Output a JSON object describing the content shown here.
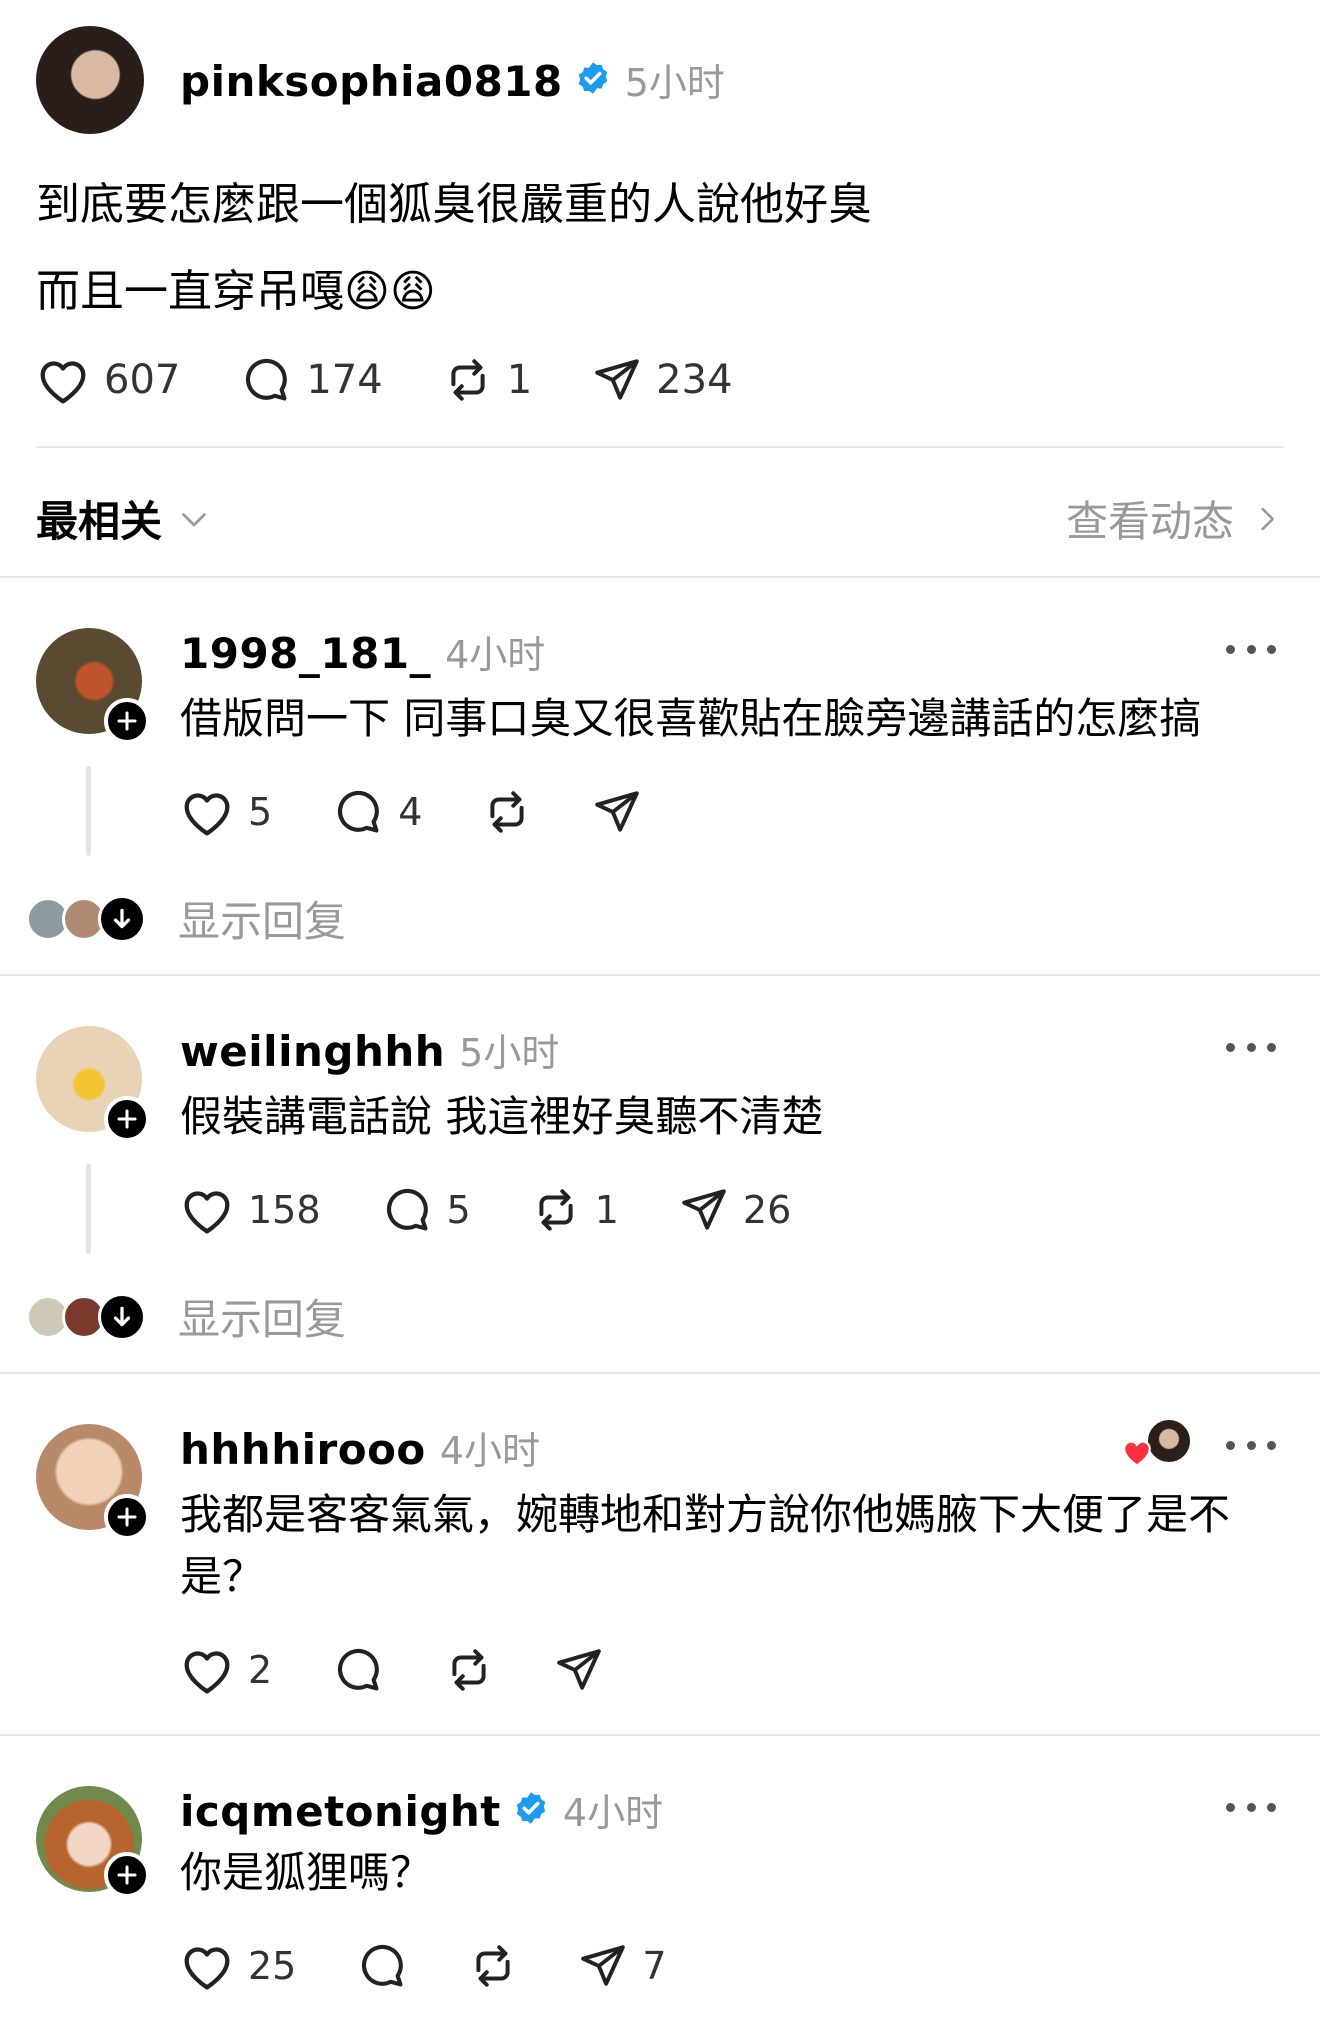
{
  "post": {
    "username": "pinksophia0818",
    "time": "5小时",
    "text_line1": "到底要怎麼跟一個狐臭很嚴重的人說他好臭",
    "text_line2": "而且一直穿吊嘎",
    "emoji": "😩😩",
    "likes": "607",
    "comments": "174",
    "reposts": "1",
    "shares": "234"
  },
  "sort": {
    "label": "最相关",
    "activity_label": "查看动态"
  },
  "comments": [
    {
      "username": "1998_181_",
      "time": "4小时",
      "text": "借版問一下 同事口臭又很喜歡貼在臉旁邊講話的怎麼搞",
      "likes": "5",
      "comments": "4",
      "reposts": "",
      "shares": "",
      "show_replies": "显示回复"
    },
    {
      "username": "weilinghhh",
      "time": "5小时",
      "text": "假裝講電話說 我這裡好臭聽不清楚",
      "likes": "158",
      "comments": "5",
      "reposts": "1",
      "shares": "26",
      "show_replies": "显示回复"
    },
    {
      "username": "hhhhirooo",
      "time": "4小时",
      "text": "我都是客客氣氣，婉轉地和對方說你他媽腋下大便了是不是？",
      "likes": "2",
      "comments": "",
      "reposts": "",
      "shares": ""
    },
    {
      "username": "icqmetonight",
      "time": "4小时",
      "text": "你是狐狸嗎？",
      "likes": "25",
      "comments": "",
      "reposts": "",
      "shares": "7"
    }
  ],
  "icons": [
    "heart-icon",
    "comment-icon",
    "repost-icon",
    "share-icon",
    "verified-icon",
    "more-icon",
    "chevron-down-icon",
    "chevron-right-icon",
    "follow-plus-icon",
    "arrow-down-icon"
  ],
  "colors": {
    "verified": "#1d9bf0",
    "like_red": "#ff3040",
    "muted": "#999999"
  }
}
